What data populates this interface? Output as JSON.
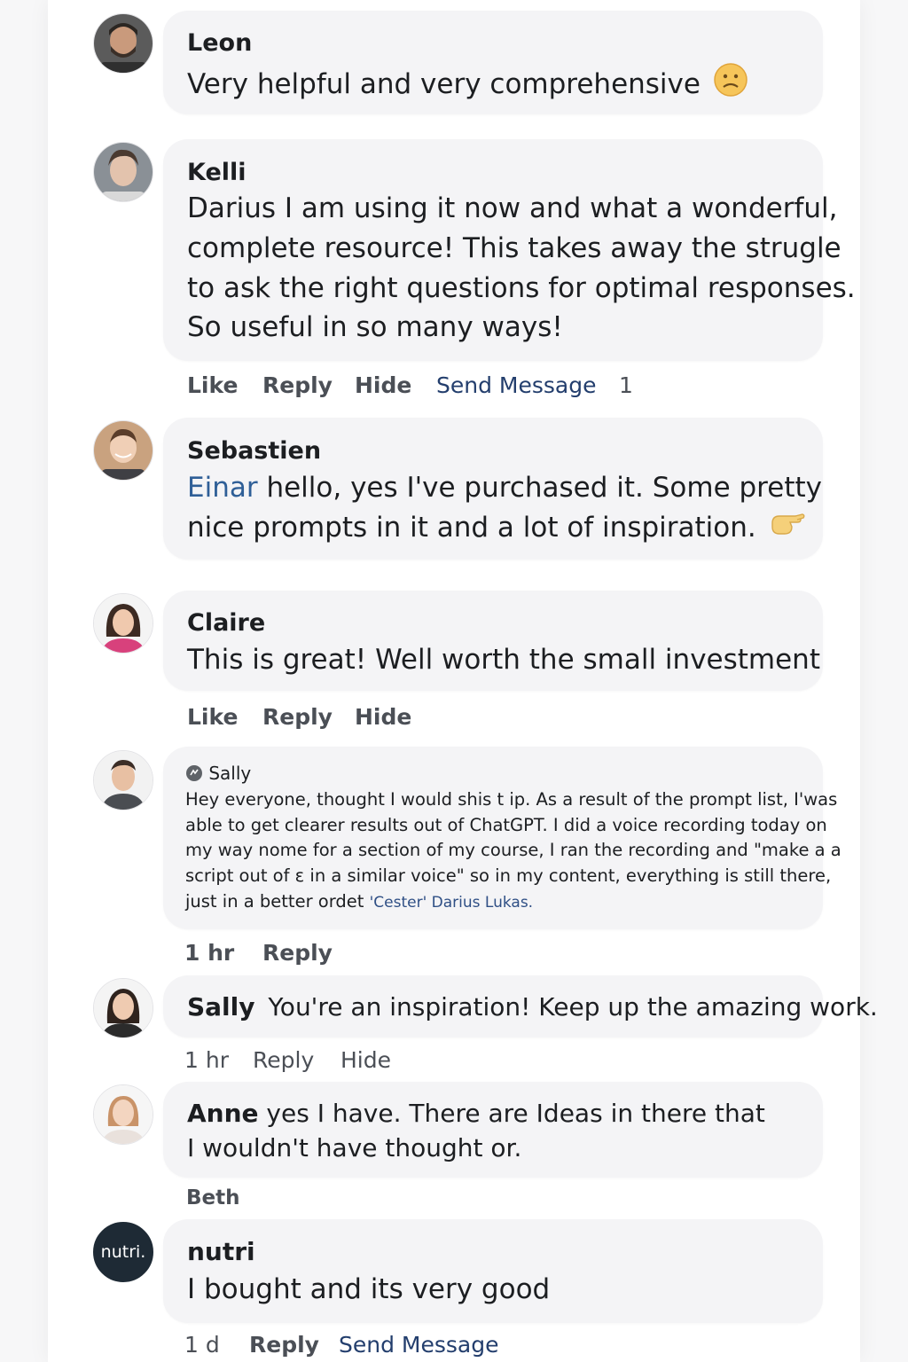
{
  "comments": {
    "leon": {
      "author": "Leon",
      "text": "Very helpful and very comprehensive"
    },
    "kelli": {
      "author": "Kelli",
      "lines": [
        "Darius I am using it now and what a wonderful,",
        "complete resource! This takes away the strugle",
        "to ask the right questions for optimal responses.",
        "So useful in so many ways!"
      ],
      "actions": {
        "like": "Like",
        "reply": "Reply",
        "hide": "Hide",
        "send_message": "Send Message",
        "count": "1"
      }
    },
    "sebastien": {
      "author": "Sebastien",
      "mention": "Einar",
      "line1": " hello, yes I've purchased it. Some pretty",
      "line2": "nice prompts in it and a lot of inspiration."
    },
    "claire": {
      "author": "Claire",
      "text": "This is great! Well worth the small investment",
      "actions": {
        "like": "Like",
        "reply": "Reply",
        "hide": "Hide"
      }
    },
    "sally_post": {
      "author": "Sally",
      "lines": [
        "Hey everyone, thought I would shis t ip. As a result of the prompt list, I'was",
        "able to get clearer results out of ChatGPT. I did a voice recording today on",
        "my way nome for a section of my course, I ran the recording and \"make a a",
        "script out of ε in a similar voice\" so in my content, everything is still there,"
      ],
      "last_line": "just in a better ordet ",
      "last_mention": "'Cester' Darius Lukas.",
      "meta": {
        "time": "1 hr",
        "reply": "Reply"
      }
    },
    "sally_reply": {
      "author": "Sally",
      "text": "You're an inspiration! Keep up the amazing work.",
      "meta": {
        "time": "1 hr",
        "reply": "Reply",
        "hide": "Hide"
      }
    },
    "anne": {
      "author": "Anne",
      "line1": " yes I have. There are Ideas in there that",
      "line2": "I wouldn't have thought or."
    },
    "beth": {
      "label": "Beth"
    },
    "nutri": {
      "author": "nutri",
      "avatar_text": "nutri.",
      "text": "I bought and its very good",
      "meta": {
        "time": "1 d",
        "reply": "Reply",
        "send_message": "Send Message"
      }
    }
  },
  "icons": {
    "leon_emoji": "frowning-face-icon",
    "sebastien_emoji": "pointing-hand-icon",
    "sally_badge": "group-badge-icon"
  },
  "colors": {
    "bubble": "#f4f4f6",
    "link": "#233e6d",
    "mention": "#2f5f97"
  }
}
